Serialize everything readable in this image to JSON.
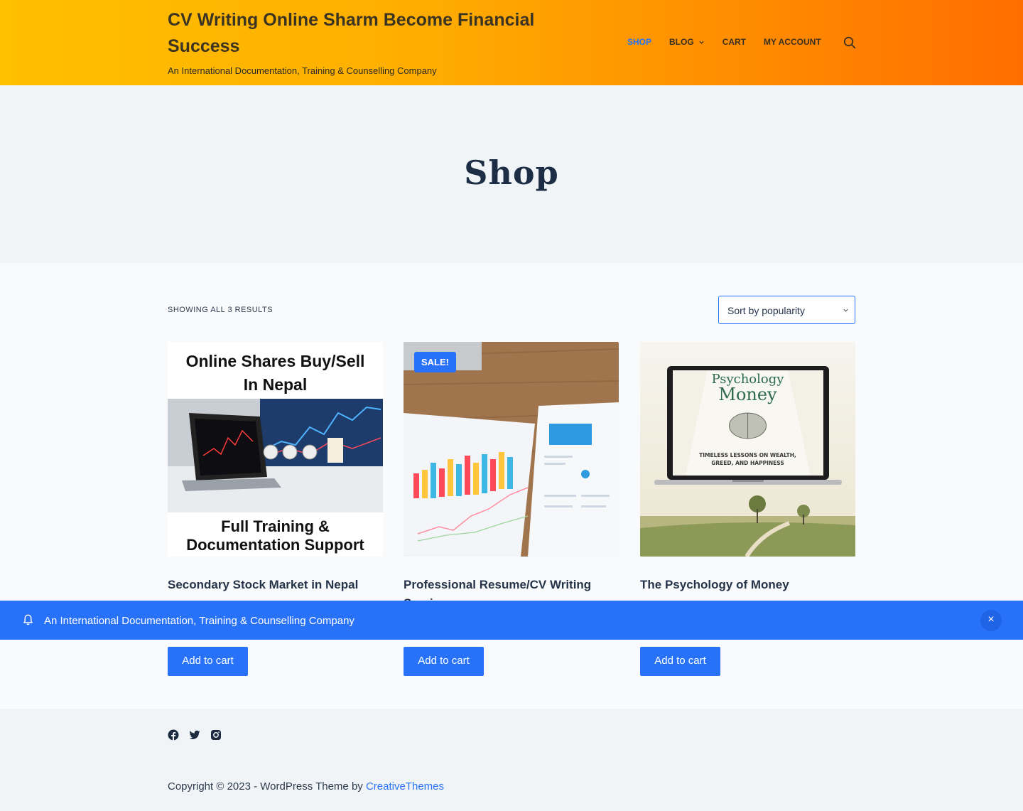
{
  "header": {
    "site_title": "CV Writing  Online Sharm  Become Financial Success",
    "tagline": "An International Documentation, Training & Counselling Company",
    "nav": [
      {
        "label": "SHOP"
      },
      {
        "label": "BLOG"
      },
      {
        "label": "CART"
      },
      {
        "label": "MY ACCOUNT"
      }
    ],
    "search_icon": "search-icon"
  },
  "hero": {
    "title": "Shop"
  },
  "toolbar": {
    "results_text": "SHOWING ALL 3 RESULTS",
    "sort_value": "Sort by popularity"
  },
  "products": [
    {
      "title": "Secondary Stock Market in Nepal",
      "image_heading": "Online Shares Buy/Sell In Nepal",
      "image_footer": "Full Training & Documentation Support",
      "button": "Add to cart"
    },
    {
      "title": "Professional Resume/CV Writing Service",
      "badge": "SALE!",
      "button": "Add to cart"
    },
    {
      "title": "The Psychology of Money",
      "image_heading": "Psychology of Money",
      "image_subtitle": "TIMELESS LESSONS ON WEALTH, GREED, AND HAPPINESS",
      "button": "Add to cart"
    }
  ],
  "notice": {
    "text": "An International Documentation, Training & Counselling Company",
    "close": "×",
    "icon": "bell-icon"
  },
  "footer": {
    "social": [
      "facebook-icon",
      "twitter-icon",
      "instagram-icon"
    ],
    "copyright_prefix": "Copyright © 2023 - WordPress Theme by",
    "copyright_link": "CreativeThemes"
  },
  "colors": {
    "accent": "#2872fa",
    "header_start": "#ffc000",
    "header_end": "#ff6d00"
  }
}
